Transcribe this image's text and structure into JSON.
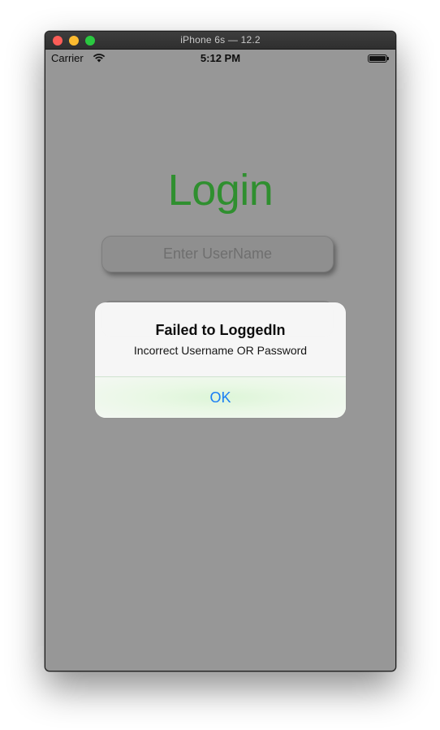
{
  "window": {
    "title": "iPhone 6s — 12.2"
  },
  "status_bar": {
    "carrier": "Carrier",
    "time": "5:12 PM"
  },
  "login": {
    "title": "Login",
    "username_placeholder": "Enter UserName",
    "password_placeholder": ""
  },
  "alert": {
    "title": "Failed to LoggedIn",
    "message": "Incorrect Username OR Password",
    "ok_label": "OK"
  },
  "colors": {
    "accent_green": "#2f8f2f",
    "ios_blue": "#1a7ef5",
    "dimmed_background": "#979797"
  }
}
